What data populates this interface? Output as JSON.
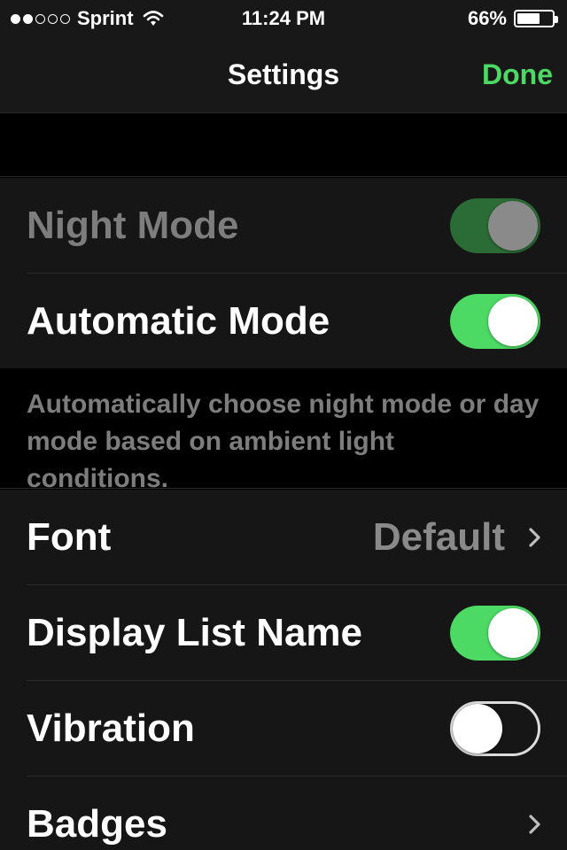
{
  "status_bar": {
    "carrier": "Sprint",
    "signal_bars_filled": 2,
    "signal_bars_total": 5,
    "time": "11:24 PM",
    "battery_percent": "66%",
    "battery_level": 0.66
  },
  "nav": {
    "title": "Settings",
    "done_label": "Done"
  },
  "display_group": {
    "night_mode": {
      "label": "Night Mode",
      "state": "on",
      "enabled": false
    },
    "automatic_mode": {
      "label": "Automatic Mode",
      "state": "on",
      "enabled": true
    },
    "footer": "Automatically choose night mode or day mode based on ambient light conditions."
  },
  "options_group": {
    "font": {
      "label": "Font",
      "value": "Default"
    },
    "display_list_name": {
      "label": "Display List Name",
      "state": "on"
    },
    "vibration": {
      "label": "Vibration",
      "state": "off"
    },
    "badges": {
      "label": "Badges"
    }
  },
  "colors": {
    "accent_green": "#4cd964",
    "background": "#000000",
    "cell_background": "#161616"
  }
}
